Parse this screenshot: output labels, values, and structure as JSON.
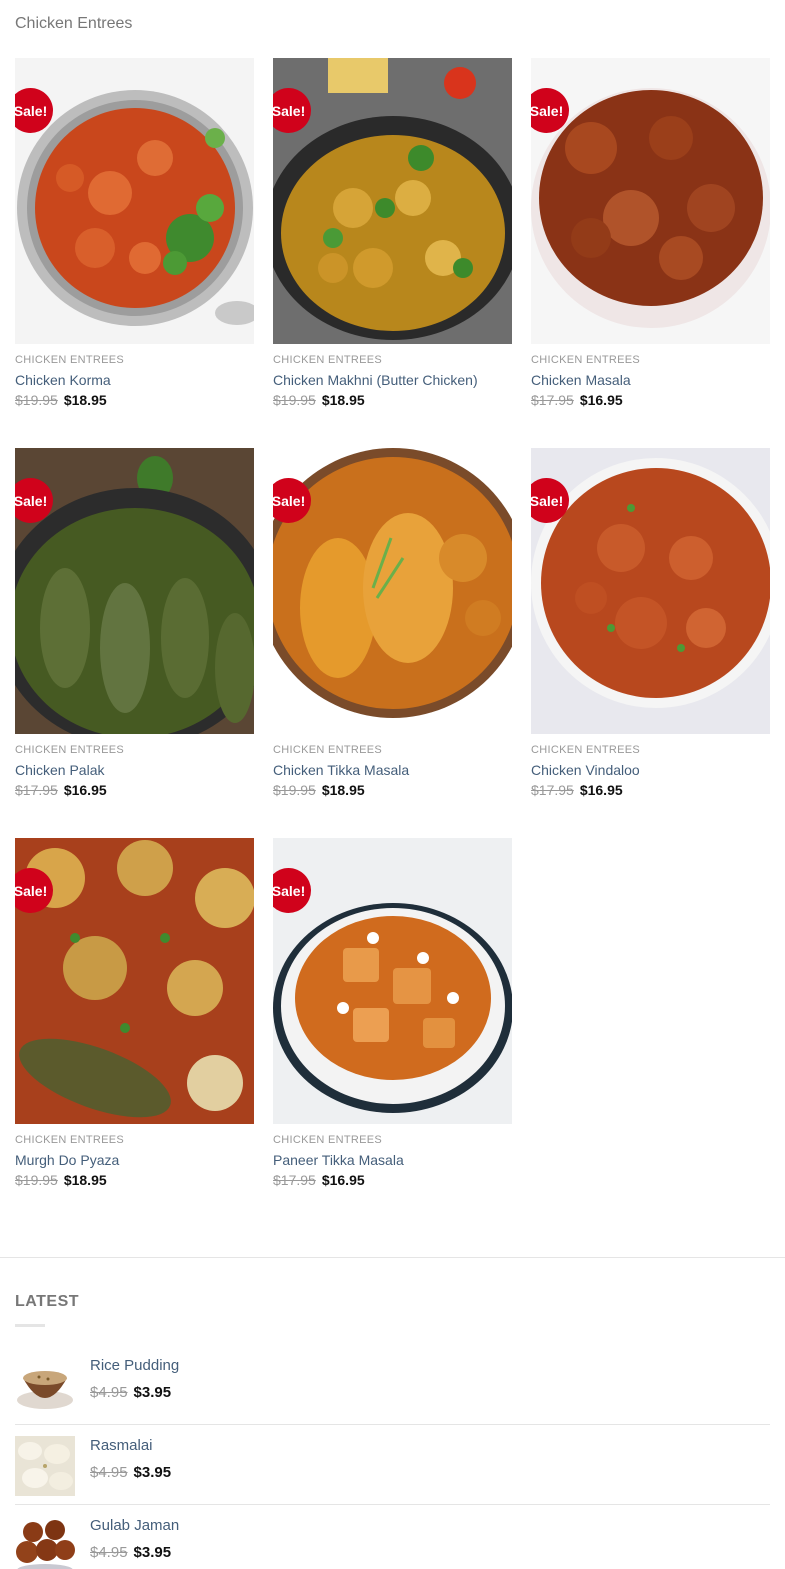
{
  "page": {
    "title": "Chicken Entrees"
  },
  "products": [
    {
      "category": "CHICKEN ENTREES",
      "name": "Chicken Korma",
      "old_price": "$19.95",
      "new_price": "$18.95",
      "badge": "Sale!"
    },
    {
      "category": "CHICKEN ENTREES",
      "name": "Chicken Makhni (Butter Chicken)",
      "old_price": "$19.95",
      "new_price": "$18.95",
      "badge": "Sale!"
    },
    {
      "category": "CHICKEN ENTREES",
      "name": "Chicken Masala",
      "old_price": "$17.95",
      "new_price": "$16.95",
      "badge": "Sale!"
    },
    {
      "category": "CHICKEN ENTREES",
      "name": "Chicken Palak",
      "old_price": "$17.95",
      "new_price": "$16.95",
      "badge": "Sale!"
    },
    {
      "category": "CHICKEN ENTREES",
      "name": "Chicken Tikka Masala",
      "old_price": "$19.95",
      "new_price": "$18.95",
      "badge": "Sale!"
    },
    {
      "category": "CHICKEN ENTREES",
      "name": "Chicken Vindaloo",
      "old_price": "$17.95",
      "new_price": "$16.95",
      "badge": "Sale!"
    },
    {
      "category": "CHICKEN ENTREES",
      "name": "Murgh Do Pyaza",
      "old_price": "$19.95",
      "new_price": "$18.95",
      "badge": "Sale!"
    },
    {
      "category": "CHICKEN ENTREES",
      "name": "Paneer Tikka Masala",
      "old_price": "$17.95",
      "new_price": "$16.95",
      "badge": "Sale!"
    }
  ],
  "latest": {
    "heading": "LATEST",
    "items": [
      {
        "name": "Rice Pudding",
        "old_price": "$4.95",
        "new_price": "$3.95"
      },
      {
        "name": "Rasmalai",
        "old_price": "$4.95",
        "new_price": "$3.95"
      },
      {
        "name": "Gulab Jaman",
        "old_price": "$4.95",
        "new_price": "$3.95"
      }
    ]
  }
}
